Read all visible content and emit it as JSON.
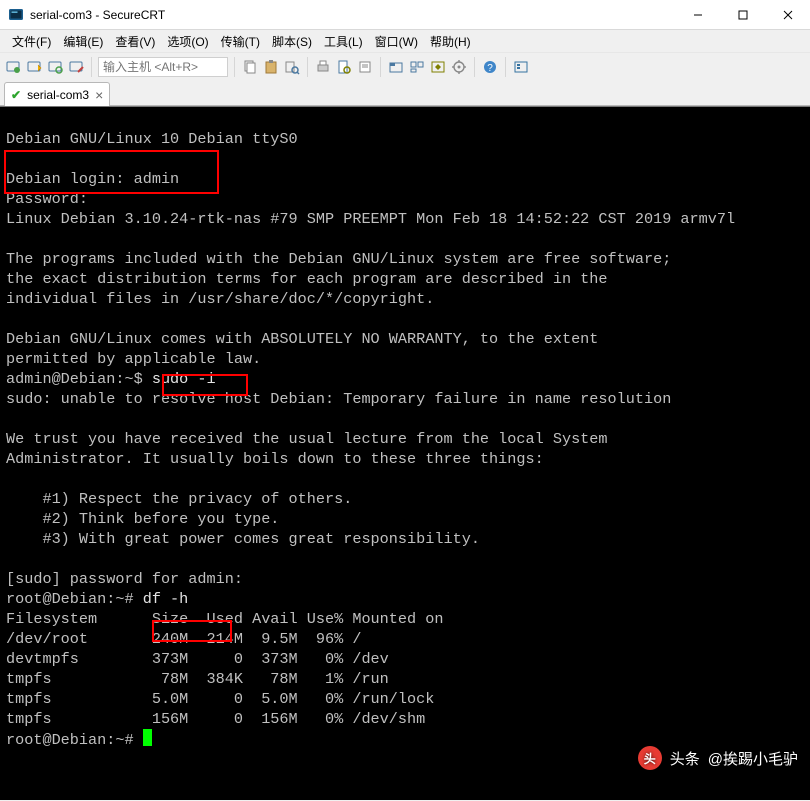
{
  "window": {
    "title": "serial-com3 - SecureCRT"
  },
  "menu": {
    "file": "文件(F)",
    "edit": "编辑(E)",
    "view": "查看(V)",
    "options": "选项(O)",
    "transfer": "传输(T)",
    "script": "脚本(S)",
    "tools": "工具(L)",
    "window": "窗口(W)",
    "help": "帮助(H)"
  },
  "toolbar": {
    "host_placeholder": "输入主机 <Alt+R>"
  },
  "tab": {
    "label": "serial-com3"
  },
  "terminal": {
    "banner1": "Debian GNU/Linux 10 Debian ttyS0",
    "login_prompt": "Debian login: admin",
    "password_prompt": "Password:",
    "kernel": "Linux Debian 3.10.24-rtk-nas #79 SMP PREEMPT Mon Feb 18 14:52:22 CST 2019 armv7l",
    "motd1": "The programs included with the Debian GNU/Linux system are free software;",
    "motd2": "the exact distribution terms for each program are described in the",
    "motd3": "individual files in /usr/share/doc/*/copyright.",
    "motd4": "Debian GNU/Linux comes with ABSOLUTELY NO WARRANTY, to the extent",
    "motd5": "permitted by applicable law.",
    "prompt1": "admin@Debian:~$ ",
    "cmd1": "sudo -i",
    "sudo_err": "sudo: unable to resolve host Debian: Temporary failure in name resolution",
    "lecture1": "We trust you have received the usual lecture from the local System",
    "lecture2": "Administrator. It usually boils down to these three things:",
    "lecture_item1": "    #1) Respect the privacy of others.",
    "lecture_item2": "    #2) Think before you type.",
    "lecture_item3": "    #3) With great power comes great responsibility.",
    "sudo_pw": "[sudo] password for admin:",
    "prompt2": "root@Debian:~# ",
    "cmd2": "df -h",
    "df_header": "Filesystem      Size  Used Avail Use% Mounted on",
    "df_rows": [
      "/dev/root       240M  214M  9.5M  96% /",
      "devtmpfs        373M     0  373M   0% /dev",
      "tmpfs            78M  384K   78M   1% /run",
      "tmpfs           5.0M     0  5.0M   0% /run/lock",
      "tmpfs           156M     0  156M   0% /dev/shm"
    ],
    "prompt3": "root@Debian:~# "
  },
  "watermark": {
    "brand": "头条",
    "handle": "@挨踢小毛驴"
  }
}
